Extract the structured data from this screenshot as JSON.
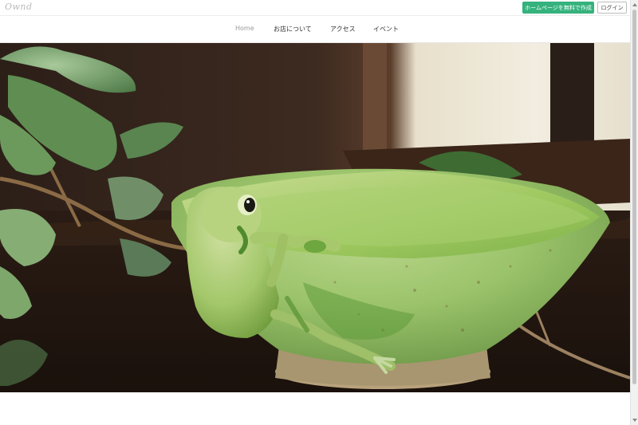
{
  "header": {
    "logo_text": "Ownd",
    "create_homepage_label": "ホームページを無料で作成",
    "login_label": "ログイン"
  },
  "nav": {
    "items": [
      {
        "label": "Home",
        "active": true
      },
      {
        "label": "お店について",
        "active": false
      },
      {
        "label": "アクセス",
        "active": false
      },
      {
        "label": "イベント",
        "active": false
      }
    ]
  },
  "colors": {
    "accent_green": "#35b27d"
  }
}
